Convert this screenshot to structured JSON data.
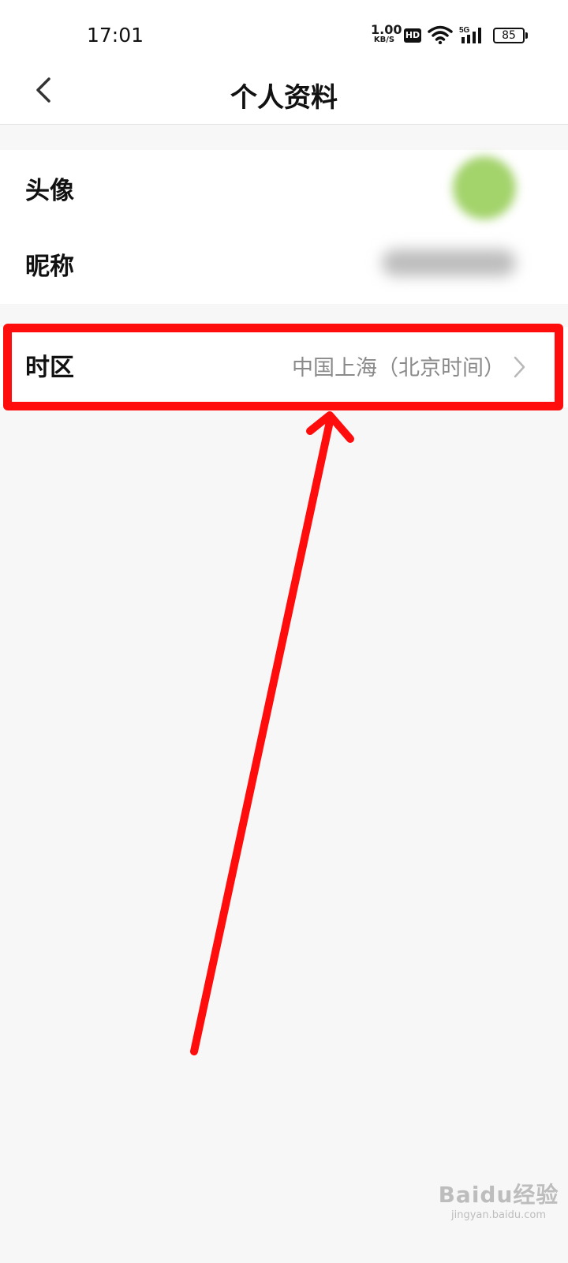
{
  "status_bar": {
    "time": "17:01",
    "net_speed_value": "1.00",
    "net_speed_unit": "KB/S",
    "hd_label": "HD",
    "signal_label": "5G",
    "battery": "85"
  },
  "nav": {
    "title": "个人资料",
    "back_icon": "chevron-left-icon"
  },
  "profile": {
    "avatar_label": "头像",
    "nickname_label": "昵称",
    "timezone_label": "时区",
    "timezone_value": "中国上海（北京时间）"
  },
  "colors": {
    "page_bg": "#f7f7f7",
    "card_bg": "#ffffff",
    "highlight": "#ff0d0d",
    "secondary_text": "#8a8a8a"
  },
  "watermark": {
    "brand": "Baidu经验",
    "url": "jingyan.baidu.com"
  }
}
